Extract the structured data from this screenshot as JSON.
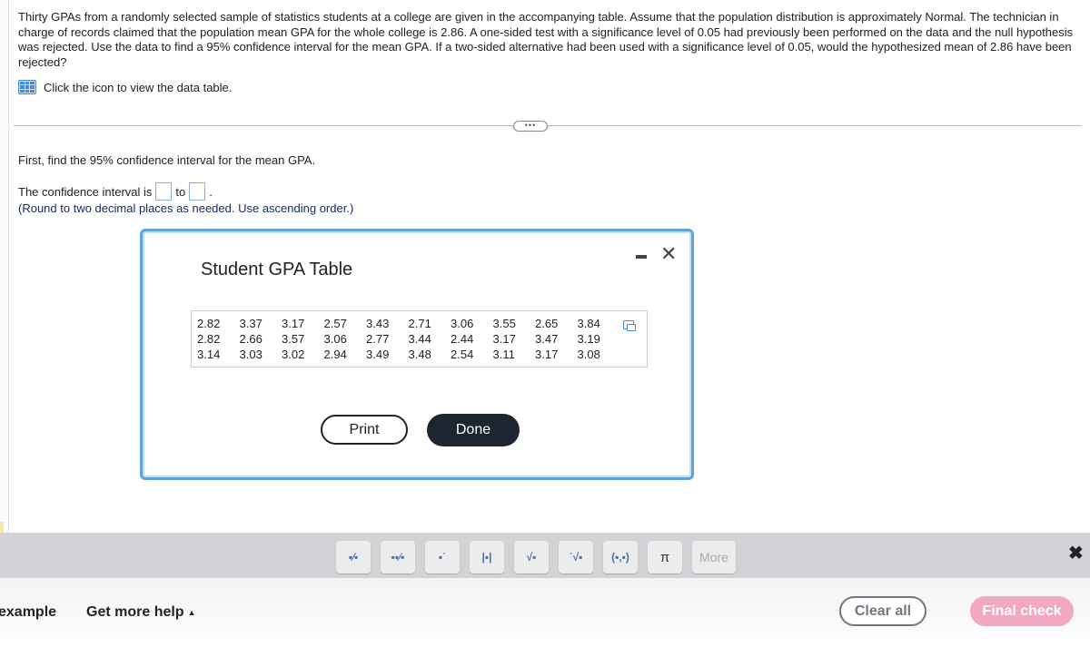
{
  "question": {
    "text": "Thirty GPAs from a randomly selected sample of statistics students at a college are given in the accompanying table. Assume that the population distribution is approximately Normal. The technician in charge of records claimed that the population mean GPA for the whole college is 2.86. A one-sided test with a significance level of 0.05 had previously been performed on the data and the null hypothesis was rejected. Use the data to find a 95% confidence interval for the mean GPA. If a two-sided alternative had been used with a significance level of 0.05, would the hypothesized mean of 2.86 have been rejected?",
    "hint": "Click the icon to view the data table.",
    "hint_icon": "table-icon",
    "expand_label": "•••"
  },
  "step": {
    "prompt": "First, find the 95% confidence interval for the mean GPA.",
    "ci_prefix": "The confidence interval is",
    "ci_mid": "to",
    "ci_suffix": ".",
    "lower_value": "",
    "upper_value": "",
    "note": "(Round to two decimal places as needed. Use ascending order.)"
  },
  "dialog": {
    "title": "Student GPA Table",
    "minimize_icon": "minimize-icon",
    "close_label": "✕",
    "rows": [
      [
        "2.82",
        "3.37",
        "3.17",
        "2.57",
        "3.43",
        "2.71",
        "3.06",
        "3.55",
        "2.65",
        "3.84"
      ],
      [
        "2.82",
        "2.66",
        "3.57",
        "3.06",
        "2.77",
        "3.44",
        "2.44",
        "3.17",
        "3.47",
        "3.19"
      ],
      [
        "3.14",
        "3.03",
        "3.02",
        "2.94",
        "3.49",
        "3.48",
        "2.54",
        "3.11",
        "3.17",
        "3.08"
      ]
    ],
    "copy_icon": "copy-icon",
    "print_label": "Print",
    "done_label": "Done"
  },
  "toolbar": {
    "tools": [
      {
        "name": "fraction",
        "glyph": "▪⁄▪"
      },
      {
        "name": "mixed-number",
        "glyph": "▪▪⁄▪"
      },
      {
        "name": "exponent",
        "glyph": "▪˙"
      },
      {
        "name": "absolute-value",
        "glyph": "|▪|"
      },
      {
        "name": "square-root",
        "glyph": "√▪"
      },
      {
        "name": "nth-root",
        "glyph": "˙√▪"
      },
      {
        "name": "ordered-pair",
        "glyph": "(▪,▪)"
      },
      {
        "name": "pi",
        "glyph": "π"
      }
    ],
    "more_label": "More",
    "close_label": "✖"
  },
  "footer": {
    "example_label": "example",
    "help_label": "Get more help",
    "help_caret": "▲",
    "clear_label": "Clear all",
    "final_label": "Final check"
  },
  "colors": {
    "accent": "#5ea4d6",
    "done_bg": "#1c2530",
    "final_check": "#f2a9bf",
    "note_text": "#1a2a6c"
  }
}
